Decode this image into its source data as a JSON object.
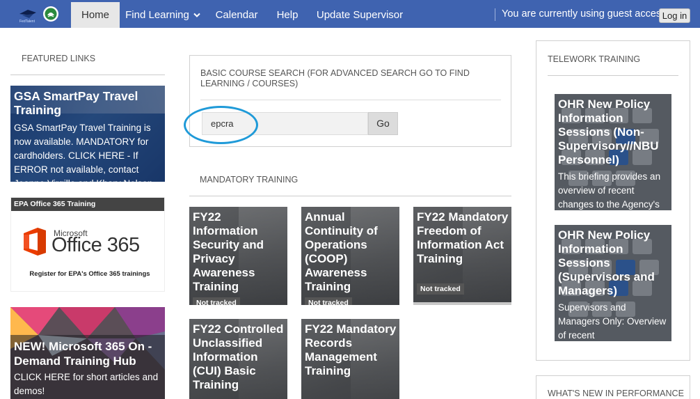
{
  "colors": {
    "navbar": "#3f63b0",
    "accent_circle": "#1f9ad8",
    "tile_bg": "#4a4c4f"
  },
  "nav": {
    "items": [
      {
        "label": "Home",
        "active": true
      },
      {
        "label": "Find Learning",
        "has_dropdown": true,
        "icon": "chevron-down-icon"
      },
      {
        "label": "Calendar"
      },
      {
        "label": "Help"
      },
      {
        "label": "Update Supervisor"
      }
    ],
    "guest_text": "You are currently using guest access",
    "login_label": "Log in"
  },
  "featured": {
    "heading": "FEATURED LINKS",
    "cards": [
      {
        "title": "GSA SmartPay Travel Training",
        "description": "GSA SmartPay Travel Training is now available. MANDATORY for cardholders. CLICK HERE - If ERROR not available, contact Jeanne Virgillo and Khary Nelson"
      },
      {
        "banner": "EPA Office 365 Training",
        "logo_small": "Microsoft",
        "logo_text": "Office 365",
        "caption": "Register for EPA's Office 365 trainings"
      },
      {
        "title": "NEW! Microsoft 365 On - Demand Training Hub",
        "description": "CLICK HERE for short articles and demos!"
      }
    ]
  },
  "search": {
    "heading": "BASIC COURSE SEARCH (FOR ADVANCED SEARCH GO TO FIND LEARNING / COURSES)",
    "value": "epcra",
    "go_label": "Go"
  },
  "mandatory": {
    "heading": "MANDATORY TRAINING",
    "tiles": [
      {
        "title": "FY22 Information Security and Privacy Awareness Training",
        "status": "Not tracked"
      },
      {
        "title": "Annual Continuity of Operations (COOP) Awareness Training",
        "status": "Not tracked"
      },
      {
        "title": "FY22 Mandatory Freedom of Information Act Training",
        "status": "Not tracked"
      },
      {
        "title": "FY22 Controlled Unclassified Information (CUI) Basic Training",
        "status": ""
      },
      {
        "title": "FY22 Mandatory Records Management Training",
        "status": ""
      }
    ]
  },
  "telework": {
    "heading": "TELEWORK TRAINING",
    "cards": [
      {
        "title": "OHR New Policy Information Sessions (Non-Supervisory//NBU Personnel)",
        "description": "This briefing provides an overview of recent changes to the Agency's"
      },
      {
        "title": "OHR New Policy Information Sessions (Supervisors and Managers)",
        "description": "Supervisors and Managers Only: Overview of recent"
      }
    ]
  },
  "performance": {
    "heading": "WHAT'S NEW IN PERFORMANCE"
  }
}
